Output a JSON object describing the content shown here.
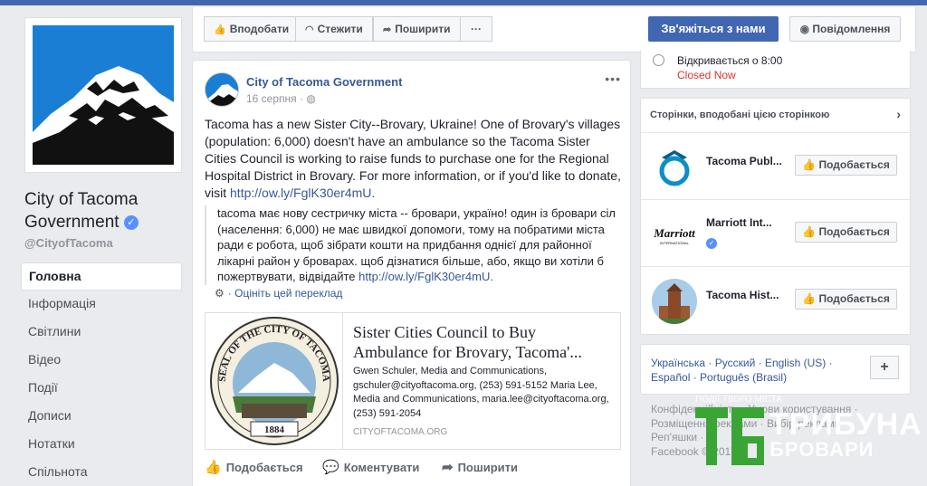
{
  "page": {
    "name": "City of Tacoma Government",
    "handle": "@CityofTacoma"
  },
  "nav": {
    "items": [
      "Головна",
      "Інформація",
      "Світлини",
      "Відео",
      "Події",
      "Дописи",
      "Нотатки",
      "Спільнота"
    ]
  },
  "actionbar": {
    "like": "Вподобати",
    "follow": "Стежити",
    "share": "Поширити",
    "more": "···",
    "contact": "Зв'яжіться з нами",
    "message": "Повідомлення"
  },
  "post": {
    "author": "City of Tacoma Government",
    "date": "16 серпня ·",
    "text": "Tacoma has a new Sister City--Brovary, Ukraine! One of Brovary's villages (population: 6,000) doesn't have an ambulance so the Tacoma Sister Cities Council is working to raise funds to purchase one for the Regional Hospital District in Brovary. For more information, or if you'd like to donate, visit",
    "url": "http://ow.ly/FglK30er4mU.",
    "translation": "tacoma має нову сестричку міста -- бровари, україно! один із бровари сіл (населення: 6,000) не має швидкої допомоги, тому на побратими міста ради є робота, щоб зібрати кошти на придбання однієї для районної лікарні район у броварах. щоб дізнатися більше, або, якщо ви хотіли б пожертвувати, відвідайте",
    "translation_url": "http://ow.ly/FglK30er4mU.",
    "rate_translation": "Оцініть цей переклад",
    "card": {
      "title": "Sister Cities Council to Buy Ambulance for Brovary, Tacoma'...",
      "description": "Gwen Schuler, Media and Communications, gschuler@cityoftacoma.org, (253) 591-5152 Maria Lee, Media and Communications, maria.lee@cityoftacoma.org, (253) 591-2054",
      "domain": "CITYOFTACOMA.ORG",
      "seal_text_top": "SEAL OF THE CITY OF TACOMA",
      "seal_year": "1884"
    },
    "actions": {
      "like": "Подобається",
      "comment": "Коментувати",
      "share": "Поширити"
    }
  },
  "hours": {
    "opens": "Відкривається о 8:00",
    "status": "Closed Now"
  },
  "liked_pages": {
    "header": "Сторінки, вподобані цією сторінкою",
    "items": [
      {
        "name": "Tacoma Publ...",
        "button": "Подобається"
      },
      {
        "name": "Marriott Int...",
        "button": "Подобається",
        "logo_text": "Marriott",
        "logo_sub": "INTERNATIONAL"
      },
      {
        "name": "Tacoma Hist...",
        "button": "Подобається"
      }
    ]
  },
  "languages": {
    "line1": "Українська · Русский · English (US) ·",
    "line2": "Español · Português (Brasil)",
    "add": "+"
  },
  "footer": {
    "line1": "Конфіденційність · Умови користування ·",
    "line2": "Розміщення реклами · Вибір реклами ·",
    "line3": "Реп'яшки ·",
    "line4": "Facebook © 2017"
  },
  "watermark": {
    "tagline": "ПОДІЇ ТВОГО МІСТА",
    "brand": "ТРИБУНА",
    "city": "БРОВАРИ"
  },
  "colors": {
    "brand_blue": "#4267b2",
    "link": "#365899",
    "closed_red": "#e0302e",
    "watermark_green": "#3aa535"
  }
}
